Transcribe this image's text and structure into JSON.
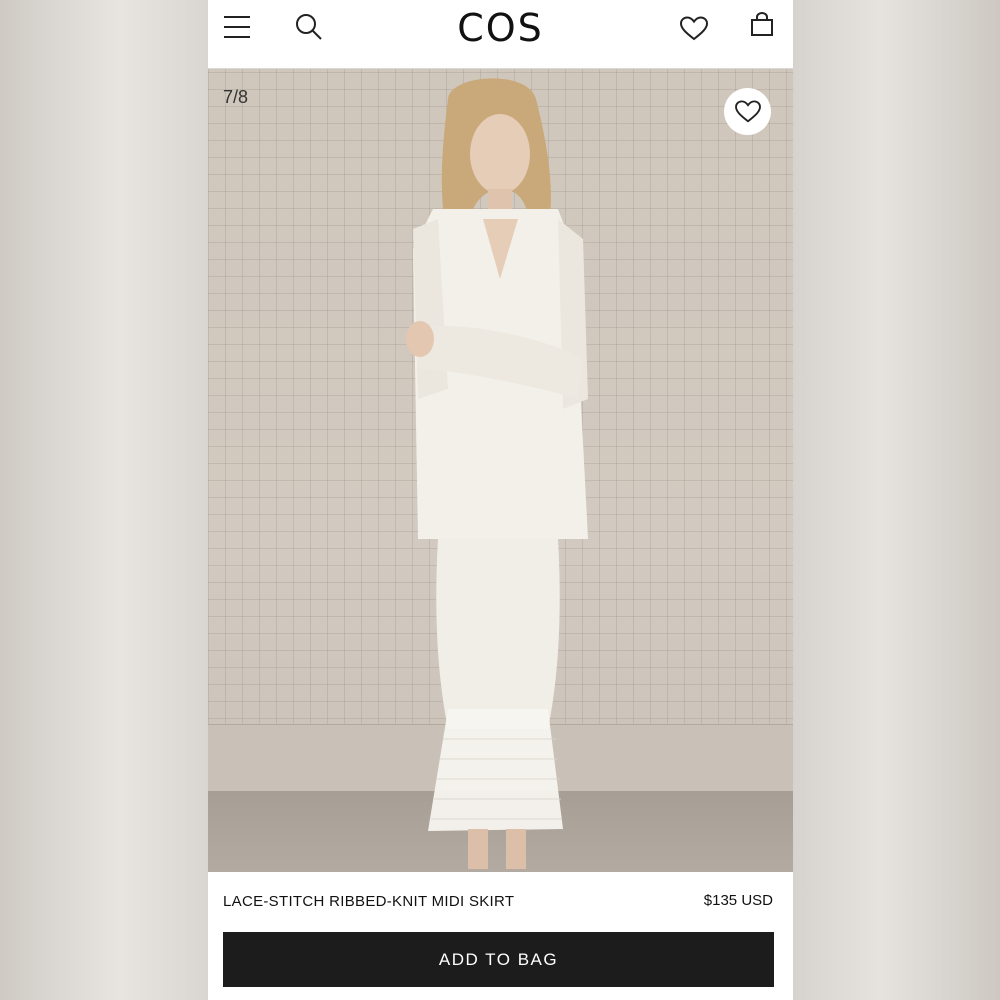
{
  "header": {
    "brand": "COS",
    "icons": [
      "menu-icon",
      "search-icon",
      "heart-icon",
      "bag-icon"
    ]
  },
  "gallery": {
    "counter": "7/8",
    "favorite_icon": "heart-icon"
  },
  "product": {
    "title": "LACE-STITCH RIBBED-KNIT MIDI SKIRT",
    "price": "$135 USD"
  },
  "actions": {
    "add_to_bag_label": "ADD TO BAG"
  },
  "colors": {
    "button_bg": "#1c1c1c",
    "text": "#111111",
    "background": "#ffffff"
  }
}
